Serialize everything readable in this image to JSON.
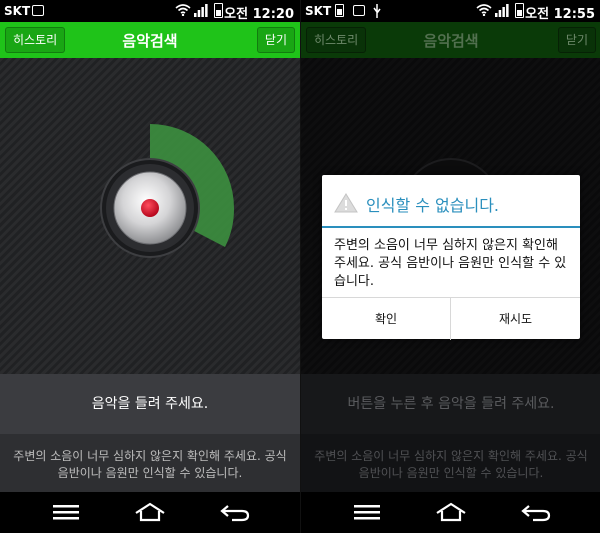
{
  "colors": {
    "accent_green": "#1fc319",
    "dialog_accent": "#2a8fbd",
    "record_red": "#d0001a"
  },
  "left": {
    "status": {
      "carrier": "SKT",
      "time": "오전 12:20"
    },
    "header": {
      "history_label": "히스토리",
      "title": "음악검색",
      "close_label": "닫기"
    },
    "prompt": "음악을 들려 주세요.",
    "hint": "주변의 소음이 너무 심하지 않은지 확인해 주세요. 공식 음반이나 음원만 인식할 수 있습니다."
  },
  "right": {
    "status": {
      "carrier": "SKT",
      "time": "오전 12:55"
    },
    "header": {
      "history_label": "히스토리",
      "title": "음악검색",
      "close_label": "닫기"
    },
    "prompt": "버튼을 누른 후 음악을 들려 주세요.",
    "hint": "주변의 소음이 너무 심하지 않은지 확인해 주세요. 공식 음반이나 음원만 인식할 수 있습니다.",
    "dialog": {
      "title": "인식할 수 없습니다.",
      "message": "주변의 소음이 너무 심하지 않은지 확인해 주세요. 공식 음반이나 음원만 인식할 수 있습니다.",
      "ok_label": "확인",
      "retry_label": "재시도"
    }
  },
  "icons": [
    "image-icon",
    "wifi-icon",
    "signal-icon",
    "battery-icon",
    "usb-icon",
    "menu-icon",
    "home-icon",
    "back-icon",
    "warning-icon",
    "record-icon"
  ]
}
